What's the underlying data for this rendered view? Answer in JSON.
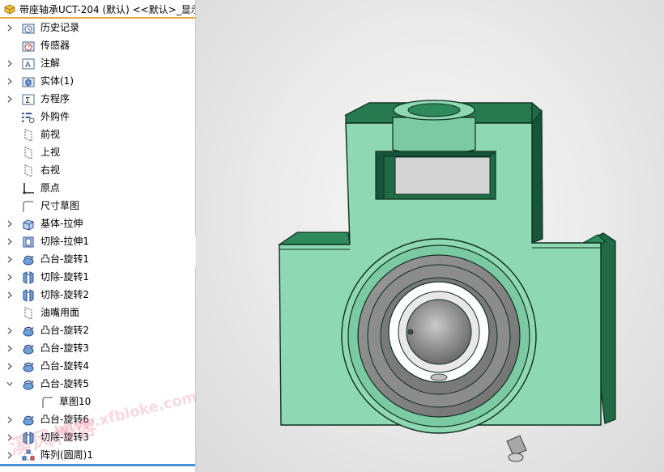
{
  "title_bar": {
    "title": "带座轴承UCT-204 (默认) <<默认>_显示"
  },
  "feature_tree": {
    "items": [
      {
        "label": "历史记录",
        "icon": "history-folder-icon",
        "expandable": true,
        "expanded": false
      },
      {
        "label": "传感器",
        "icon": "sensor-folder-icon",
        "expandable": false,
        "expanded": false
      },
      {
        "label": "注解",
        "icon": "annotations-icon",
        "expandable": true,
        "expanded": false
      },
      {
        "label": "实体(1)",
        "icon": "solid-bodies-icon",
        "expandable": true,
        "expanded": false
      },
      {
        "label": "方程序",
        "icon": "equations-icon",
        "expandable": true,
        "expanded": false
      },
      {
        "label": "外购件",
        "icon": "purchased-parts-icon",
        "expandable": false,
        "expanded": false
      },
      {
        "label": "前视",
        "icon": "plane-icon",
        "expandable": false,
        "expanded": false
      },
      {
        "label": "上视",
        "icon": "plane-icon",
        "expandable": false,
        "expanded": false
      },
      {
        "label": "右视",
        "icon": "plane-icon",
        "expandable": false,
        "expanded": false
      },
      {
        "label": "原点",
        "icon": "origin-icon",
        "expandable": false,
        "expanded": false
      },
      {
        "label": "尺寸草图",
        "icon": "sketch-icon",
        "expandable": false,
        "expanded": false
      },
      {
        "label": "基体-拉伸",
        "icon": "extrude-boss-icon",
        "expandable": true,
        "expanded": false
      },
      {
        "label": "切除-拉伸1",
        "icon": "extrude-cut-icon",
        "expandable": true,
        "expanded": false
      },
      {
        "label": "凸台-旋转1",
        "icon": "revolve-boss-icon",
        "expandable": true,
        "expanded": false
      },
      {
        "label": "切除-旋转1",
        "icon": "revolve-cut-icon",
        "expandable": true,
        "expanded": false
      },
      {
        "label": "切除-旋转2",
        "icon": "revolve-cut-icon",
        "expandable": true,
        "expanded": false
      },
      {
        "label": "油嘴用面",
        "icon": "plane-icon",
        "expandable": false,
        "expanded": false
      },
      {
        "label": "凸台-旋转2",
        "icon": "revolve-boss-icon",
        "expandable": true,
        "expanded": false
      },
      {
        "label": "凸台-旋转3",
        "icon": "revolve-boss-icon",
        "expandable": true,
        "expanded": false
      },
      {
        "label": "凸台-旋转4",
        "icon": "revolve-boss-icon",
        "expandable": true,
        "expanded": false
      },
      {
        "label": "凸台-旋转5",
        "icon": "revolve-boss-icon",
        "expandable": true,
        "expanded": true
      },
      {
        "label": "草图10",
        "icon": "sketch-icon",
        "expandable": false,
        "expanded": false,
        "child": true
      },
      {
        "label": "凸台-旋转6",
        "icon": "revolve-boss-icon",
        "expandable": true,
        "expanded": false
      },
      {
        "label": "切除-旋转3",
        "icon": "revolve-cut-icon",
        "expandable": true,
        "expanded": false
      },
      {
        "label": "阵列(圆周)1",
        "icon": "circular-pattern-icon",
        "expandable": true,
        "expanded": false
      }
    ]
  },
  "watermark": {
    "cn": "溪风博客",
    "en": "www.xfbloke.com"
  },
  "colors": {
    "model_face": "#8fd8b4",
    "model_dark": "#1f6b45",
    "model_edge": "#0d2e1f",
    "bearing_gray": "#8a8a8a",
    "accent_orange": "#e8a63a",
    "accent_blue": "#4a90d9"
  }
}
